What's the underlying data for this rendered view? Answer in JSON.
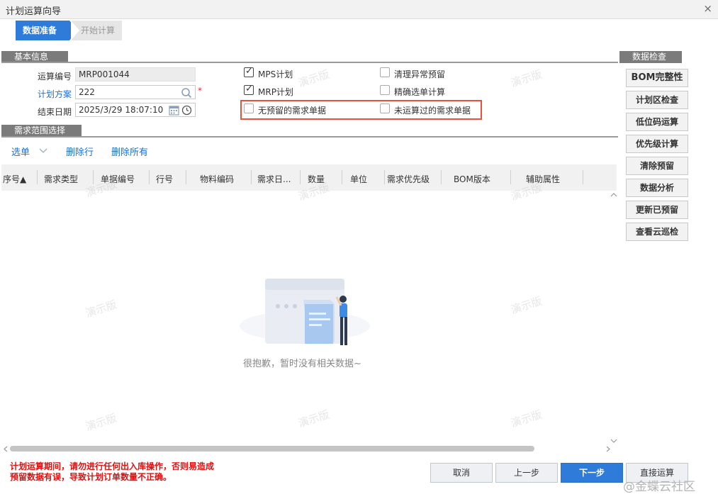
{
  "window": {
    "title": "计划运算向导",
    "close": "×"
  },
  "steps": [
    "数据准备",
    "开始计算"
  ],
  "basic_info": {
    "section_title": "基本信息",
    "calc_no_label": "运算编号",
    "calc_no_value": "MRP001044",
    "plan_label": "计划方案",
    "plan_value": "222",
    "end_date_label": "结束日期",
    "end_date_value": "2025/3/29 18:07:10",
    "required_mark": "*"
  },
  "options": {
    "mps": {
      "label": "MPS计划",
      "checked": true
    },
    "mrp": {
      "label": "MRP计划",
      "checked": true
    },
    "clear_abnormal": {
      "label": "清理异常预留",
      "checked": false
    },
    "precise_select": {
      "label": "精确选单计算",
      "checked": false
    },
    "no_reserved": {
      "label": "无预留的需求单据",
      "checked": false
    },
    "not_calculated": {
      "label": "未运算过的需求单据",
      "checked": false
    }
  },
  "demand": {
    "section_title": "需求范围选择",
    "toolbar": {
      "select": "选单",
      "delete_row": "删除行",
      "delete_all": "删除所有"
    },
    "columns": [
      "序号▲",
      "需求类型",
      "单据编号",
      "行号",
      "物料编码",
      "需求日...",
      "数量",
      "单位",
      "需求优先级",
      "BOM版本",
      "辅助属性"
    ],
    "empty_text": "很抱歉，暂时没有相关数据~"
  },
  "data_check": {
    "section_title": "数据检查",
    "buttons": [
      "BOM完整性",
      "计划区检查",
      "低位码运算",
      "优先级计算",
      "清除预留",
      "数据分析",
      "更新已预留",
      "查看云巡检"
    ]
  },
  "warning": {
    "line1": "计划运算期间，请勿进行任何出入库操作，否则易造成",
    "line2": "预留数据有误，导致计划订单数量不正确。"
  },
  "footer": {
    "cancel": "取消",
    "prev": "上一步",
    "next": "下一步",
    "direct": "直接运算"
  },
  "watermark": "演示版",
  "brand": "@金蝶云社区",
  "colors": {
    "primary": "#2f7bd9",
    "highlight_box": "#e8513a",
    "warning": "#e01010",
    "link": "#1e6fd0"
  }
}
